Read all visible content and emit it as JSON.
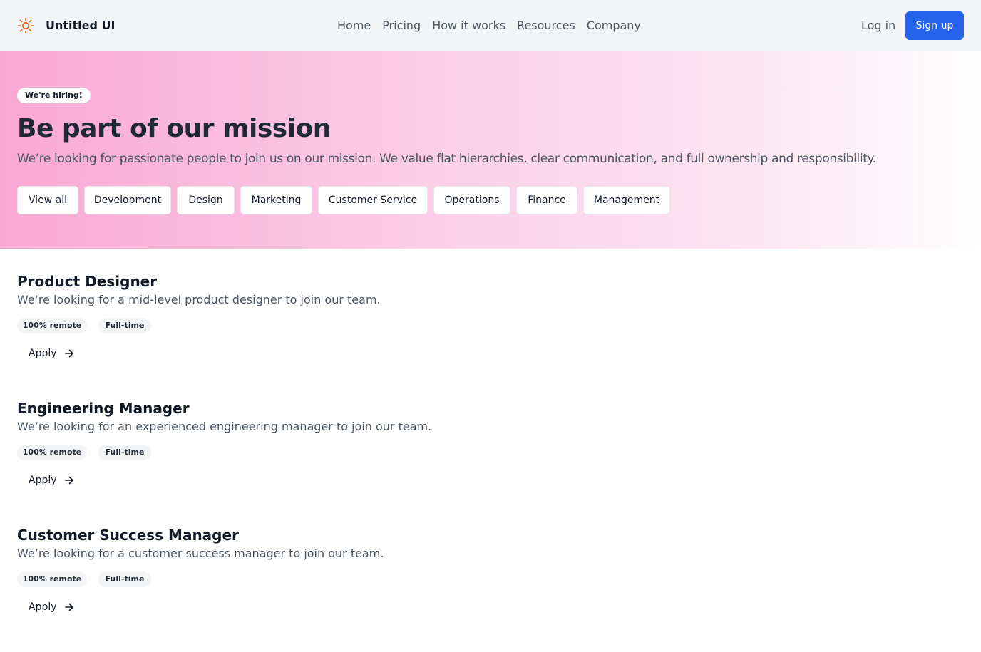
{
  "brand": {
    "name": "Untitled UI",
    "icon": "sun-icon",
    "icon_color": "#ea580c"
  },
  "nav": {
    "links": [
      "Home",
      "Pricing",
      "How it works",
      "Resources",
      "Company"
    ]
  },
  "auth": {
    "login_label": "Log in",
    "signup_label": "Sign up",
    "signup_color": "#2563eb"
  },
  "hero": {
    "badge": "We're hiring!",
    "title": "Be part of our mission",
    "subtitle": "We’re looking for passionate people to join us on our mission. We value flat hierarchies, clear communication, and full ownership and responsibility.",
    "filters": [
      "View all",
      "Development",
      "Design",
      "Marketing",
      "Customer Service",
      "Operations",
      "Finance",
      "Management"
    ],
    "gradient_start": "#f9a8d4"
  },
  "jobs": [
    {
      "title": "Product Designer",
      "description": "We’re looking for a mid-level product designer to join our team.",
      "tags": [
        "100% remote",
        "Full-time"
      ],
      "apply_label": "Apply"
    },
    {
      "title": "Engineering Manager",
      "description": "We’re looking for an experienced engineering manager to join our team.",
      "tags": [
        "100% remote",
        "Full-time"
      ],
      "apply_label": "Apply"
    },
    {
      "title": "Customer Success Manager",
      "description": "We’re looking for a customer success manager to join our team.",
      "tags": [
        "100% remote",
        "Full-time"
      ],
      "apply_label": "Apply"
    }
  ]
}
